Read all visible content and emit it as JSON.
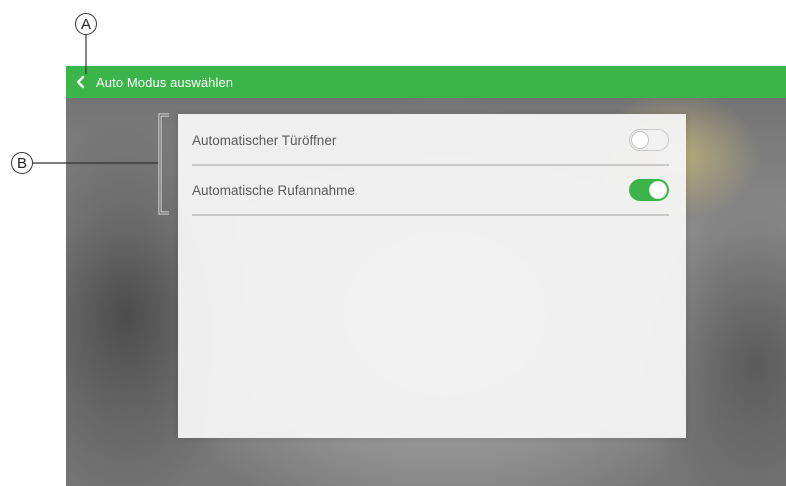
{
  "header": {
    "title": "Auto Modus auswählen",
    "back_icon": "chevron-left-icon",
    "accent_color": "#3bb54a"
  },
  "settings": [
    {
      "label": "Automatischer Türöffner",
      "enabled": false
    },
    {
      "label": "Automatische Rufannahme",
      "enabled": true
    }
  ],
  "callouts": {
    "a": "A",
    "b": "B"
  }
}
